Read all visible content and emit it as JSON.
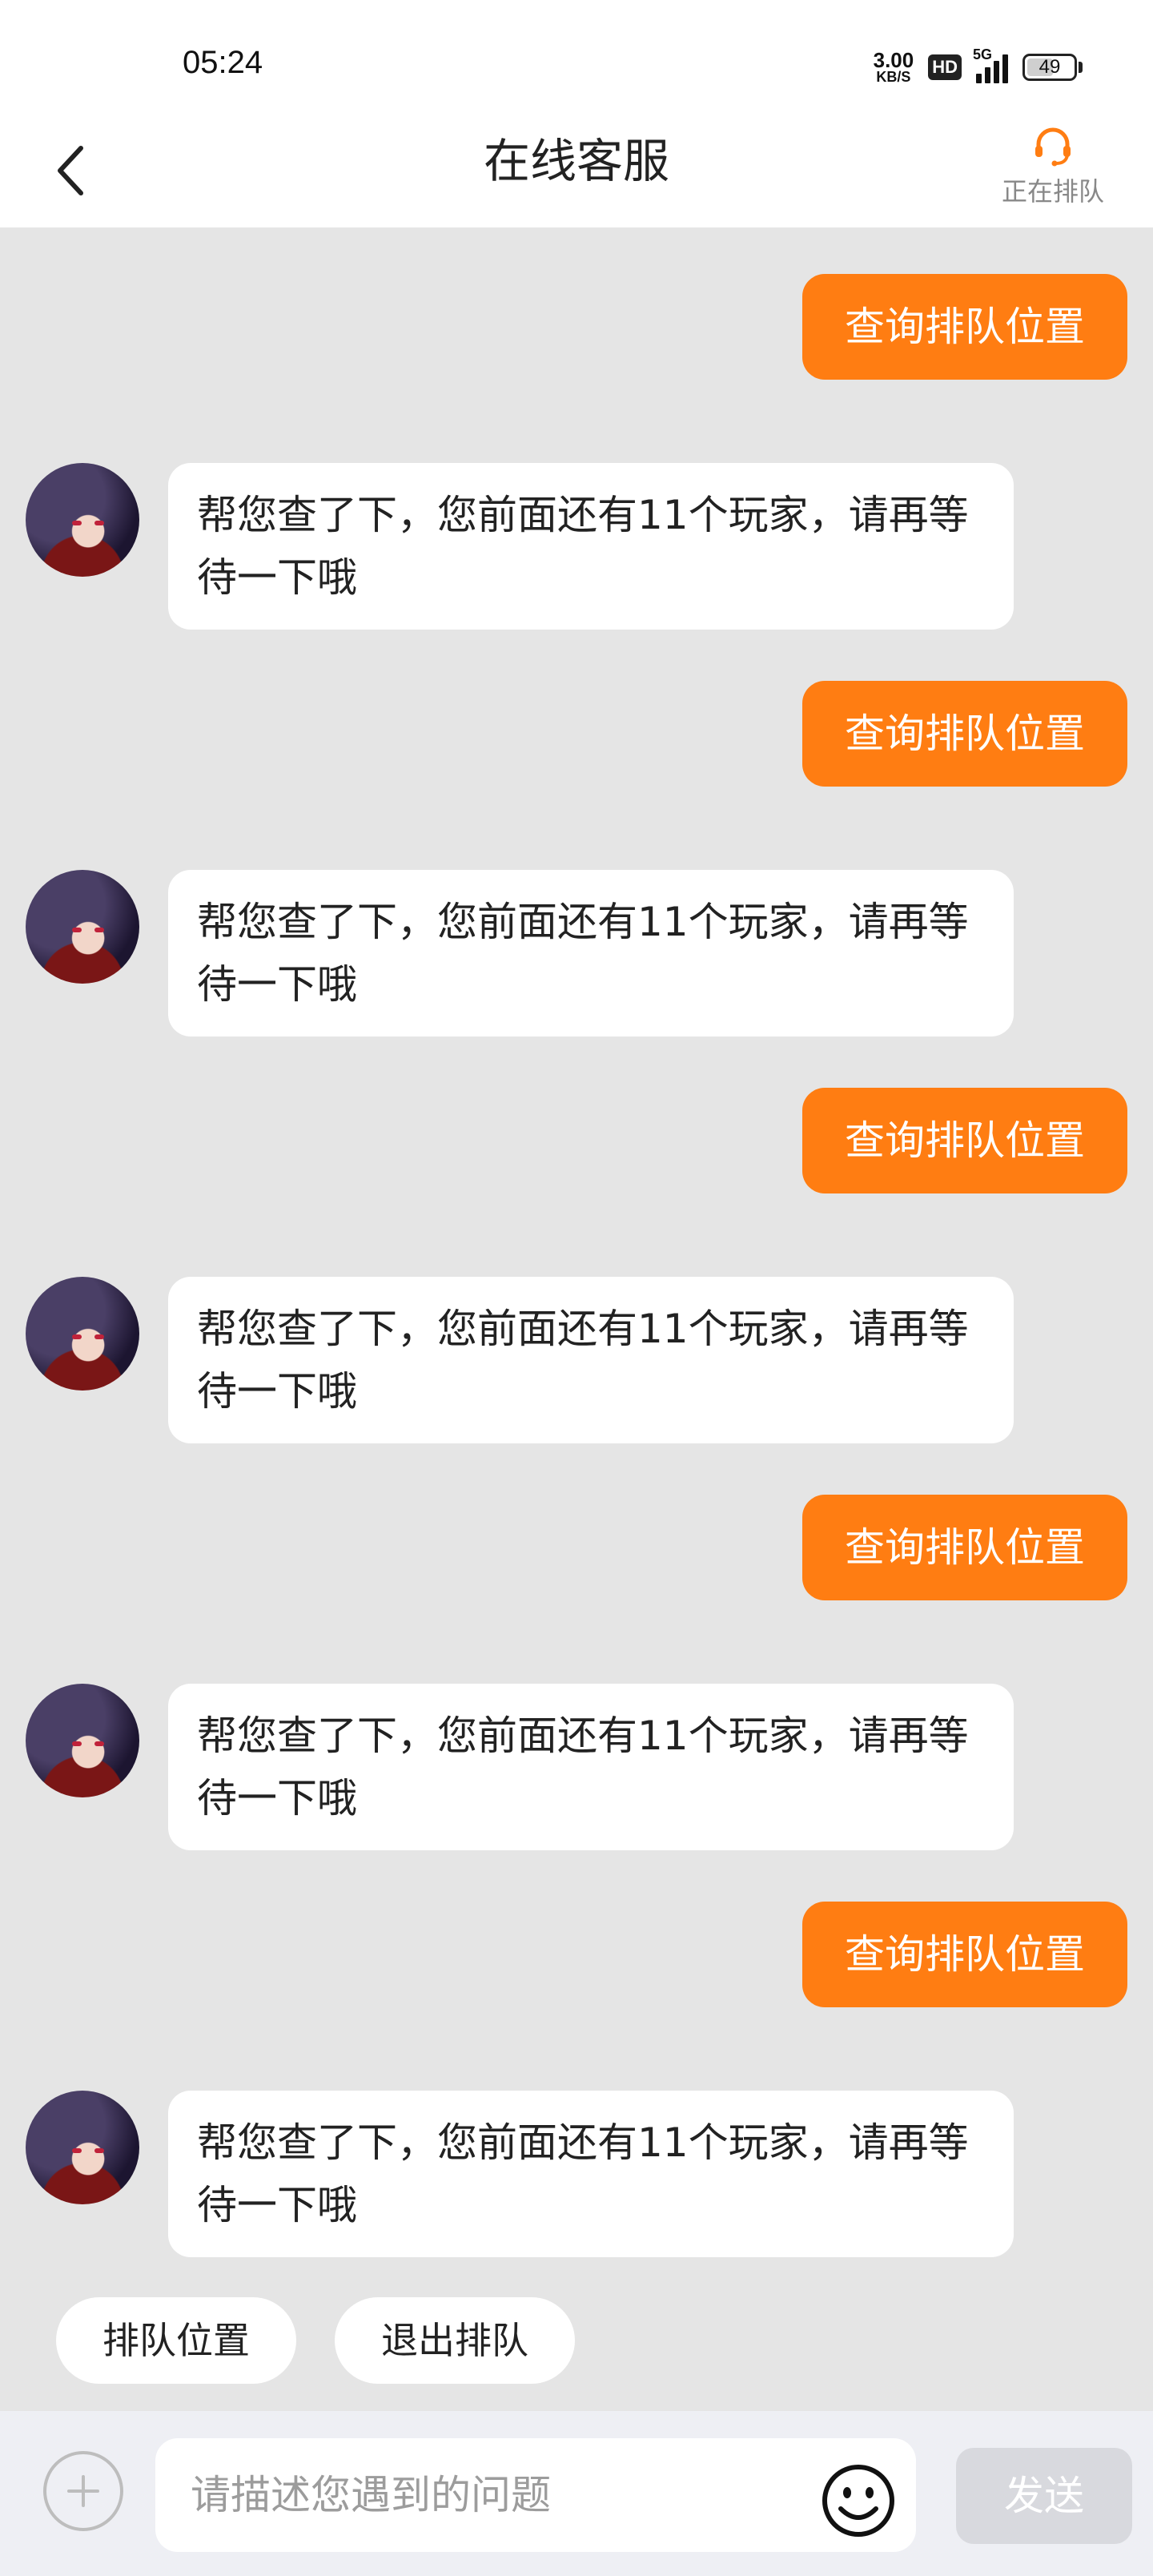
{
  "status_bar": {
    "time": "05:24",
    "net_speed_value": "3.00",
    "net_speed_unit": "KB/S",
    "hd_badge": "HD",
    "network_type": "5G",
    "battery_level": "49"
  },
  "header": {
    "title": "在线客服",
    "queue_status_label": "正在排队",
    "accent_color": "#ff7d12"
  },
  "chat": {
    "messages": [
      {
        "from": "user",
        "text": "查询排队位置"
      },
      {
        "from": "agent",
        "text": "帮您查了下，您前面还有11个玩家，请再等待一下哦"
      },
      {
        "from": "user",
        "text": "查询排队位置"
      },
      {
        "from": "agent",
        "text": "帮您查了下，您前面还有11个玩家，请再等待一下哦"
      },
      {
        "from": "user",
        "text": "查询排队位置"
      },
      {
        "from": "agent",
        "text": "帮您查了下，您前面还有11个玩家，请再等待一下哦"
      },
      {
        "from": "user",
        "text": "查询排队位置"
      },
      {
        "from": "agent",
        "text": "帮您查了下，您前面还有11个玩家，请再等待一下哦"
      },
      {
        "from": "user",
        "text": "查询排队位置"
      },
      {
        "from": "agent",
        "text": "帮您查了下，您前面还有11个玩家，请再等待一下哦"
      }
    ]
  },
  "quick_actions": [
    "排队位置",
    "退出排队"
  ],
  "input_bar": {
    "placeholder": "请描述您遇到的问题",
    "send_label": "发送"
  }
}
